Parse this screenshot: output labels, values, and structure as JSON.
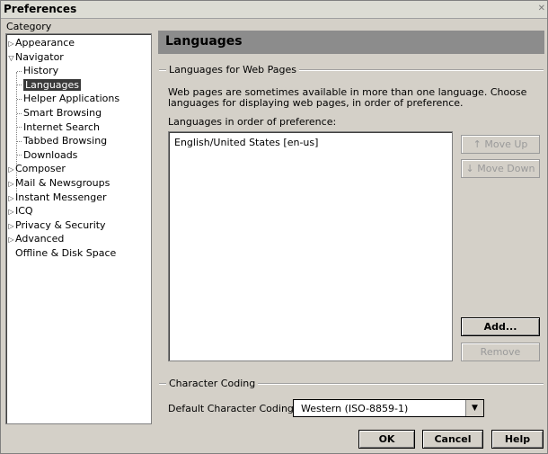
{
  "window": {
    "title": "Preferences"
  },
  "category_label": "Category",
  "tree": [
    {
      "label": "Appearance",
      "level": 0,
      "expander": "collapsed"
    },
    {
      "label": "Navigator",
      "level": 0,
      "expander": "expanded"
    },
    {
      "label": "History",
      "level": 1
    },
    {
      "label": "Languages",
      "level": 1,
      "selected": true
    },
    {
      "label": "Helper Applications",
      "level": 1
    },
    {
      "label": "Smart Browsing",
      "level": 1
    },
    {
      "label": "Internet Search",
      "level": 1
    },
    {
      "label": "Tabbed Browsing",
      "level": 1
    },
    {
      "label": "Downloads",
      "level": 1
    },
    {
      "label": "Composer",
      "level": 0,
      "expander": "collapsed"
    },
    {
      "label": "Mail & Newsgroups",
      "level": 0,
      "expander": "collapsed"
    },
    {
      "label": "Instant Messenger",
      "level": 0,
      "expander": "collapsed"
    },
    {
      "label": "ICQ",
      "level": 0,
      "expander": "collapsed"
    },
    {
      "label": "Privacy & Security",
      "level": 0,
      "expander": "collapsed"
    },
    {
      "label": "Advanced",
      "level": 0,
      "expander": "collapsed"
    },
    {
      "label": "Offline & Disk Space",
      "level": 0
    }
  ],
  "main": {
    "header": "Languages",
    "web_pages_group": "Languages for Web Pages",
    "description": "Web pages are sometimes available in more than one language. Choose languages for displaying web pages, in order of preference.",
    "order_label": "Languages in order of preference:",
    "languages": [
      "English/United States  [en-us]"
    ],
    "buttons": {
      "move_up": "Move Up",
      "move_down": "Move Down",
      "add": "Add...",
      "remove": "Remove"
    },
    "coding_group": "Character Coding",
    "coding_label": "Default Character Coding:",
    "coding_value": "Western (ISO-8859-1)"
  },
  "footer": {
    "ok": "OK",
    "cancel": "Cancel",
    "help": "Help"
  }
}
